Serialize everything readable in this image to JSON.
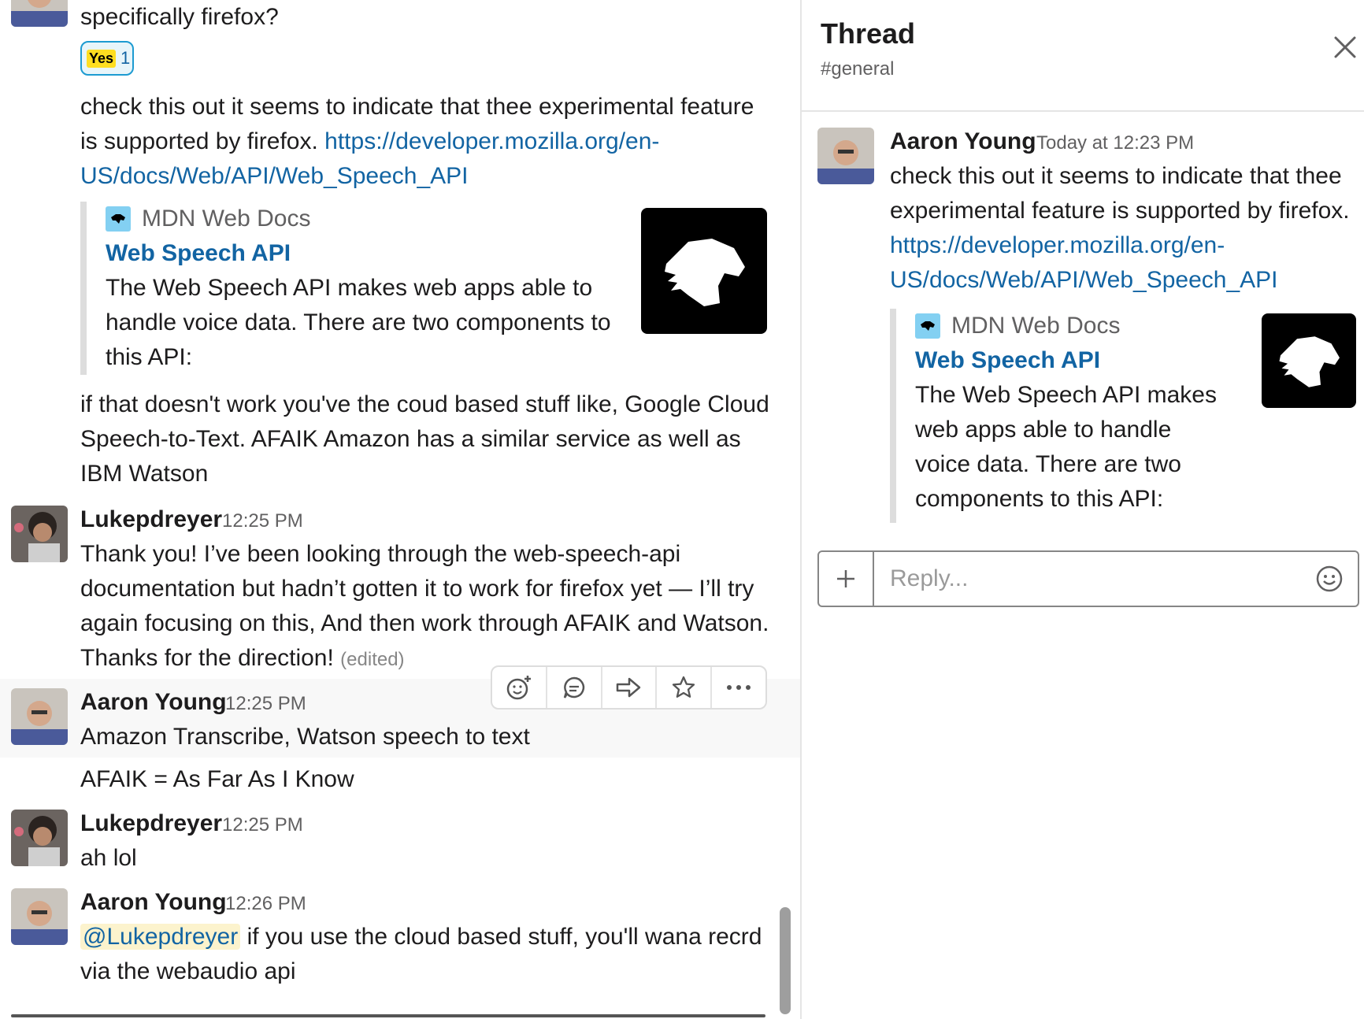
{
  "colors": {
    "link": "#1264a3",
    "mention_bg": "#fcf3cd",
    "reaction_border": "#1d9bd1"
  },
  "messages": {
    "m0": {
      "text": "specifically firefox?",
      "reaction": {
        "emoji": "Yes",
        "count": "1"
      }
    },
    "m1": {
      "text_line1": "check this out it seems to indicate that thee experimental feature",
      "text_line2": "is supported by firefox. ",
      "link_part1": "https://developer.mozilla.org/en-",
      "link_part2": "US/docs/Web/API/Web_Speech_API",
      "unfurl": {
        "site": "MDN Web Docs",
        "title": "Web Speech API",
        "desc_line1": "The Web Speech API makes web apps able to",
        "desc_line2": "handle voice data. There are two components to",
        "desc_line3": "this API:"
      }
    },
    "m2": {
      "line1": "if that doesn't work you've the coud based stuff like, Google Cloud",
      "line2": "Speech-to-Text. AFAIK Amazon has a similar service as well as",
      "line3": "IBM Watson"
    },
    "m3": {
      "author": "Lukepdreyer",
      "time": "12:25 PM",
      "line1": "Thank you! I’ve been looking through the web-speech-api",
      "line2": "documentation but hadn’t gotten it to work for firefox yet — I’ll try",
      "line3": "again focusing on this, And then work through AFAIK and Watson.",
      "line4": "Thanks for the direction! ",
      "edited": "(edited)"
    },
    "m4": {
      "author": "Aaron Young",
      "time": "12:25 PM",
      "text": "Amazon Transcribe, Watson speech to text"
    },
    "m5": {
      "text": "AFAIK = As Far As I Know"
    },
    "m6": {
      "author": "Lukepdreyer",
      "time": "12:25 PM",
      "text": "ah lol"
    },
    "m7": {
      "author": "Aaron Young",
      "time": "12:26 PM",
      "mention": "@Lukepdreyer",
      "line1_rest": " if you use the cloud based  stuff, you'll wana recrd",
      "line2": "via the webaudio api"
    }
  },
  "message_actions": {
    "icons": [
      "add-reaction-icon",
      "start-thread-icon",
      "share-icon",
      "star-icon",
      "more-icon"
    ]
  },
  "thread": {
    "title": "Thread",
    "channel": "#general",
    "message": {
      "author": "Aaron Young",
      "time": "Today at 12:23 PM",
      "line1": "check this out it seems to indicate that thee",
      "line2": "experimental feature is supported by firefox.",
      "link_part1": "https://developer.mozilla.org/en-",
      "link_part2": "US/docs/Web/API/Web_Speech_API",
      "unfurl": {
        "site": "MDN Web Docs",
        "title": "Web Speech API",
        "desc_line1": "The Web Speech API makes",
        "desc_line2": "web apps able to handle",
        "desc_line3": "voice data. There are two",
        "desc_line4": "components to this API:"
      }
    },
    "reply": {
      "placeholder": "Reply..."
    }
  }
}
